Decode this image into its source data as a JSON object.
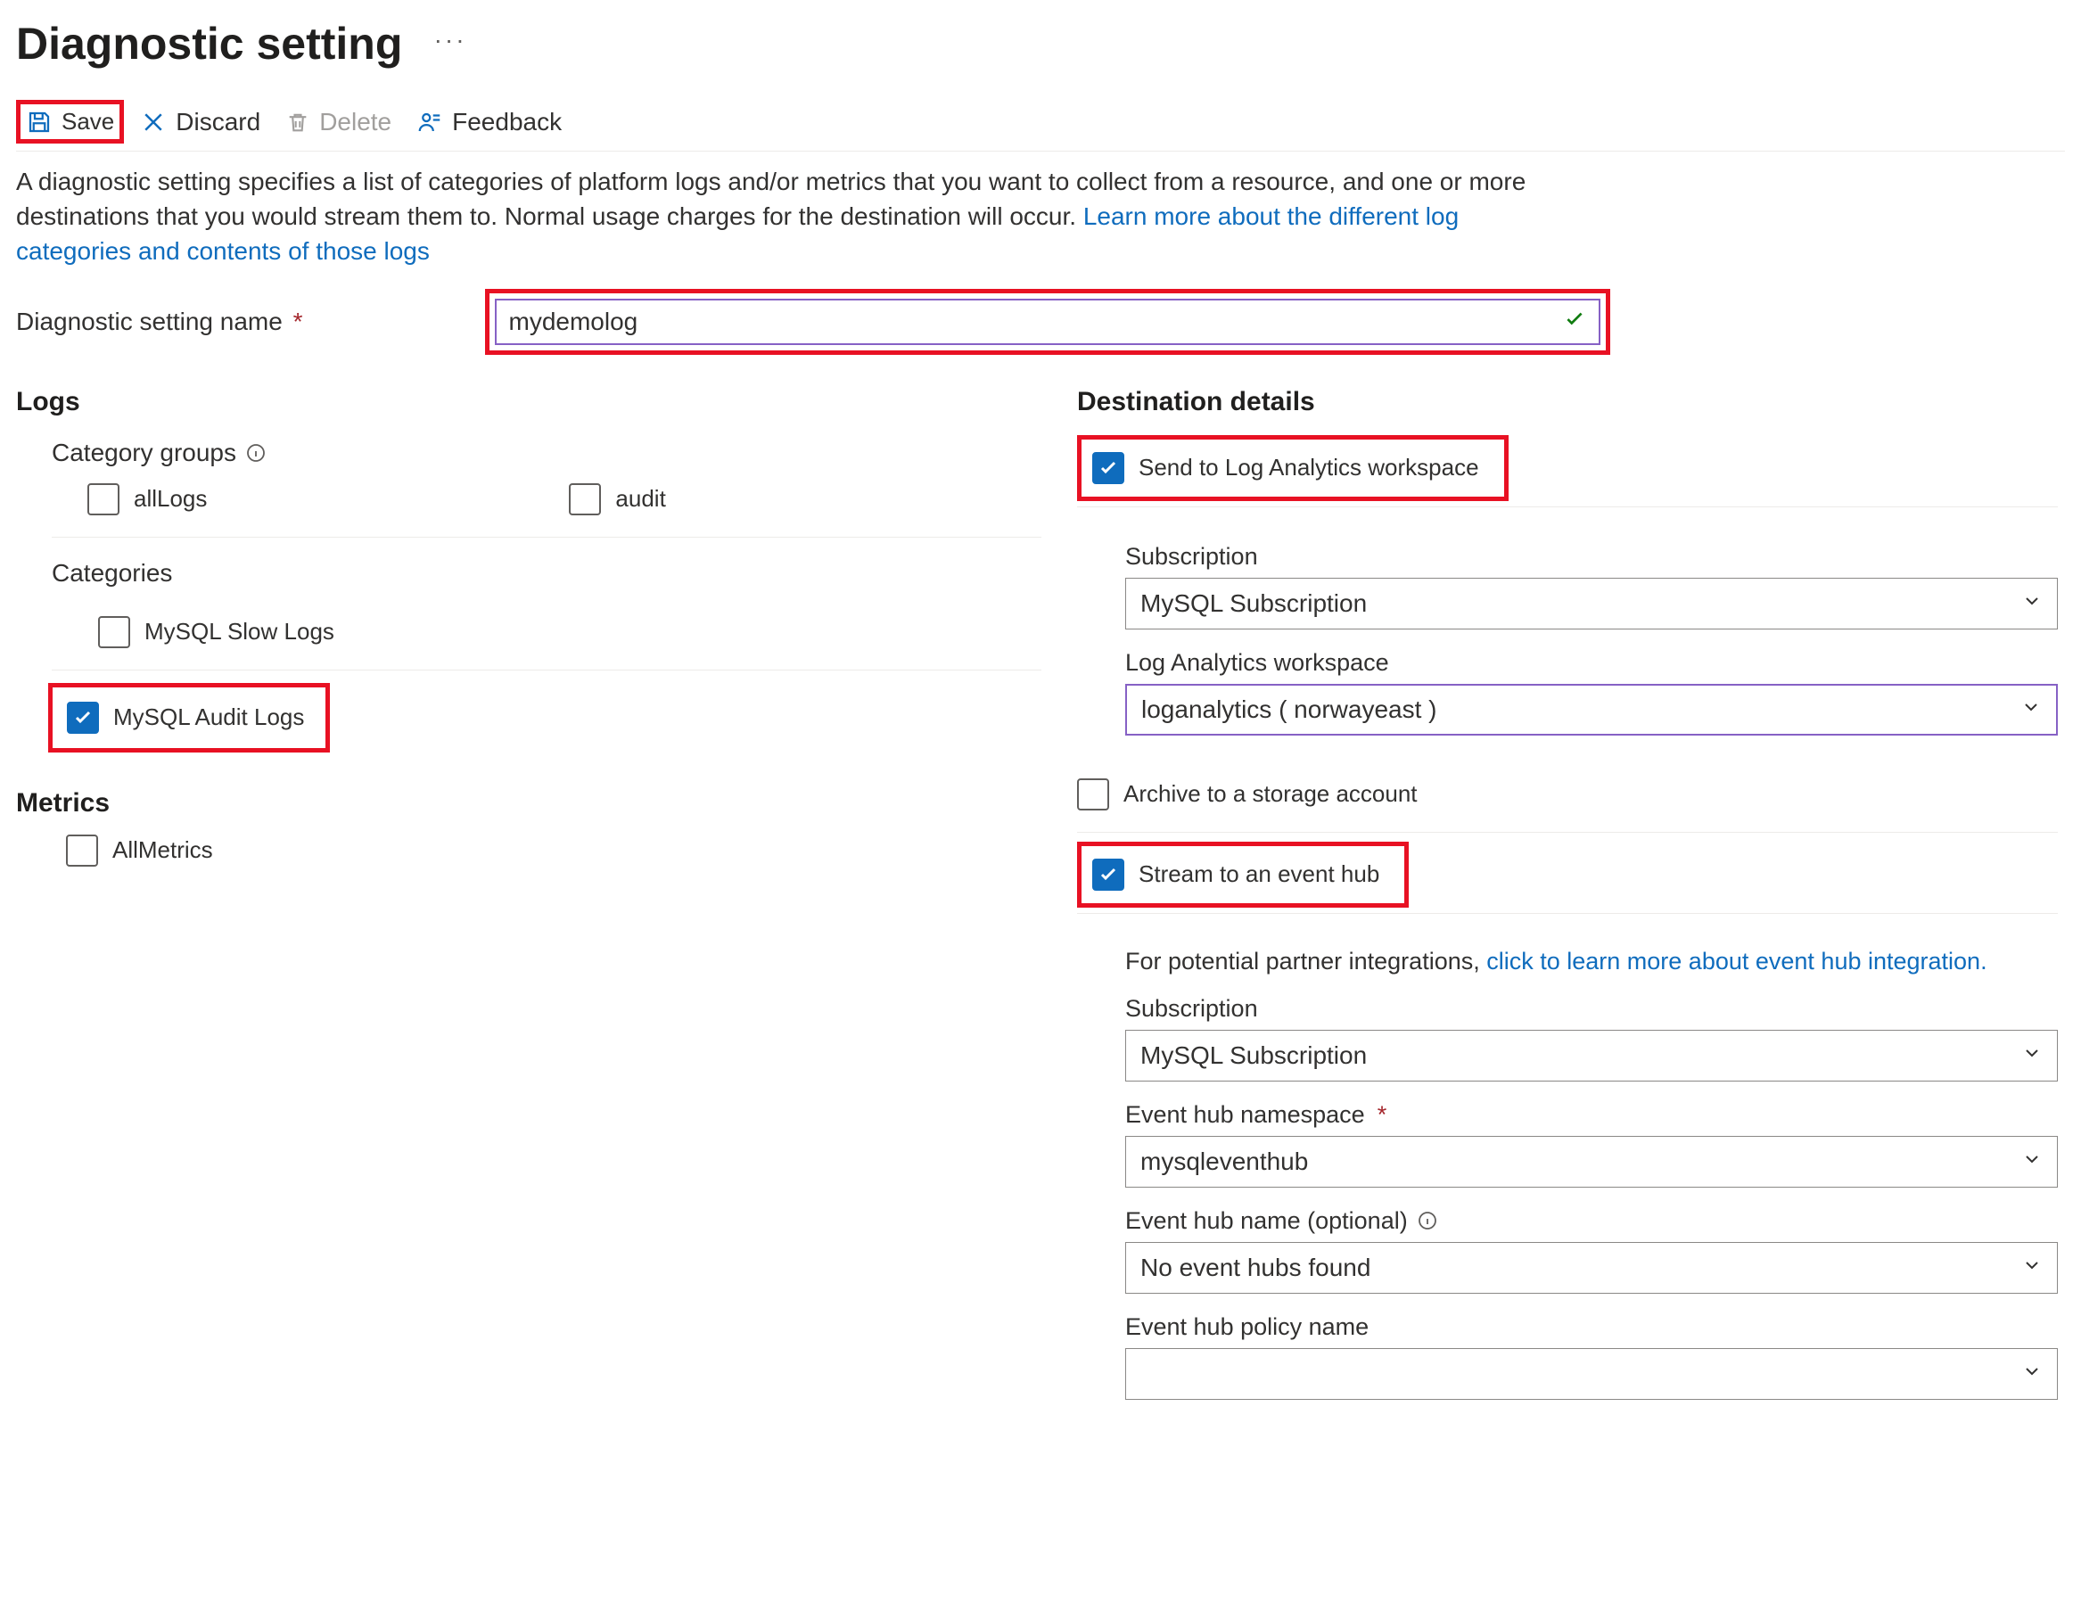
{
  "header": {
    "title": "Diagnostic setting"
  },
  "toolbar": {
    "save_label": "Save",
    "discard_label": "Discard",
    "delete_label": "Delete",
    "feedback_label": "Feedback"
  },
  "intro": {
    "text_a": "A diagnostic setting specifies a list of categories of platform logs and/or metrics that you want to collect from a resource, and one or more destinations that you would stream them to. Normal usage charges for the destination will occur. ",
    "link": "Learn more about the different log categories and contents of those logs"
  },
  "name_field": {
    "label": "Diagnostic setting name",
    "value": "mydemolog"
  },
  "logs": {
    "title": "Logs",
    "category_groups_label": "Category groups",
    "groups": [
      {
        "name": "allLogs",
        "checked": false
      },
      {
        "name": "audit",
        "checked": false
      }
    ],
    "categories_label": "Categories",
    "categories": [
      {
        "name": "MySQL Slow Logs",
        "checked": false
      },
      {
        "name": "MySQL Audit Logs",
        "checked": true
      }
    ]
  },
  "metrics": {
    "title": "Metrics",
    "items": [
      {
        "name": "AllMetrics",
        "checked": false
      }
    ]
  },
  "dest": {
    "title": "Destination details",
    "log_analytics": {
      "label": "Send to Log Analytics workspace",
      "checked": true,
      "subscription_label": "Subscription",
      "subscription_value": "MySQL  Subscription",
      "workspace_label": "Log Analytics workspace",
      "workspace_value": "loganalytics ( norwayeast )"
    },
    "storage": {
      "label": "Archive to a storage account",
      "checked": false
    },
    "eventhub": {
      "label": "Stream to an event hub",
      "checked": true,
      "note_prefix": "For potential partner integrations, ",
      "note_link": "click to learn more about event hub integration.",
      "subscription_label": "Subscription",
      "subscription_value": "MySQL  Subscription",
      "namespace_label": "Event hub namespace",
      "namespace_value": "mysqleventhub",
      "hubname_label": "Event hub name (optional)",
      "hubname_value": "No event hubs found",
      "policy_label": "Event hub policy name",
      "policy_value": ""
    }
  }
}
